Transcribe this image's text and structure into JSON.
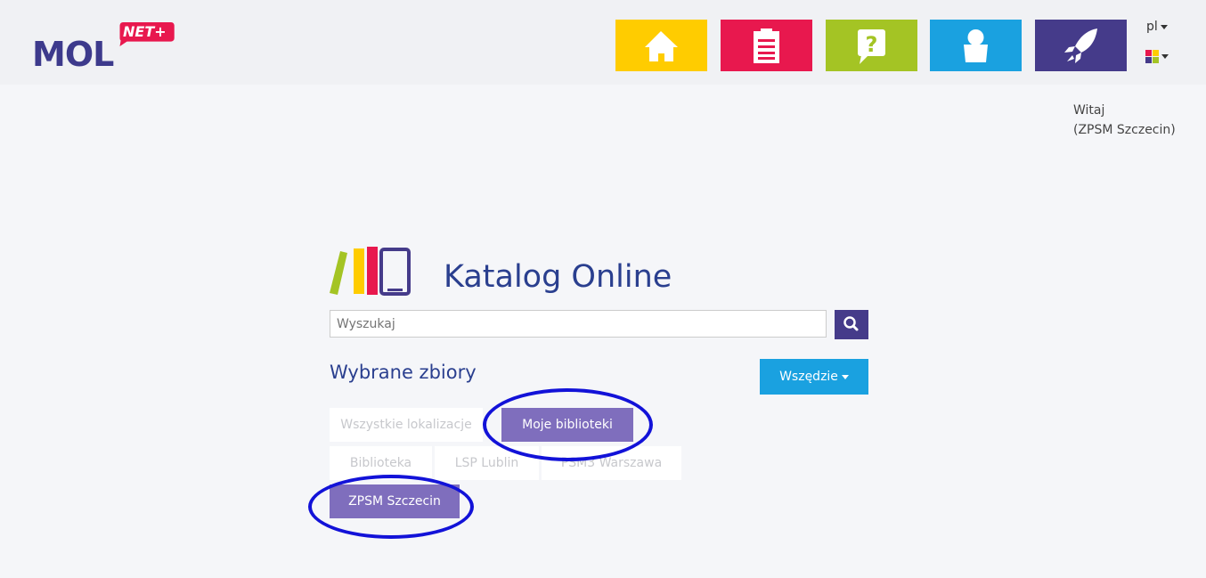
{
  "header": {
    "logo_text": "MOL",
    "logo_badge": "NET+",
    "nav_tiles": [
      {
        "icon": "home-icon",
        "color": "#ffcc00"
      },
      {
        "icon": "clipboard-icon",
        "color": "#e8184e"
      },
      {
        "icon": "question-icon",
        "color": "#a4c424"
      },
      {
        "icon": "user-icon",
        "color": "#1aa1e0"
      },
      {
        "icon": "rocket-icon",
        "color": "#453b8a"
      }
    ],
    "language": "pl"
  },
  "user": {
    "greeting": "Witaj",
    "name": "(ZPSM Szczecin)"
  },
  "catalog": {
    "title": "Katalog Online",
    "search_placeholder": "Wyszukaj"
  },
  "collections": {
    "title": "Wybrane zbiory",
    "scope_label": "Wszędzie",
    "chips": [
      {
        "label": "Wszystkie lokalizacje",
        "active": false
      },
      {
        "label": "Moje biblioteki",
        "active": true
      },
      {
        "label": "Biblioteka",
        "active": false
      },
      {
        "label": "LSP Lublin",
        "active": false
      },
      {
        "label": "PSM3 Warszawa",
        "active": false
      },
      {
        "label": "ZPSM Szczecin",
        "active": true
      }
    ]
  },
  "colors": {
    "accent": "#453b8a",
    "chip_active": "#7f6ebd",
    "highlight_ring": "#1212d8",
    "title": "#2a3f8f"
  }
}
